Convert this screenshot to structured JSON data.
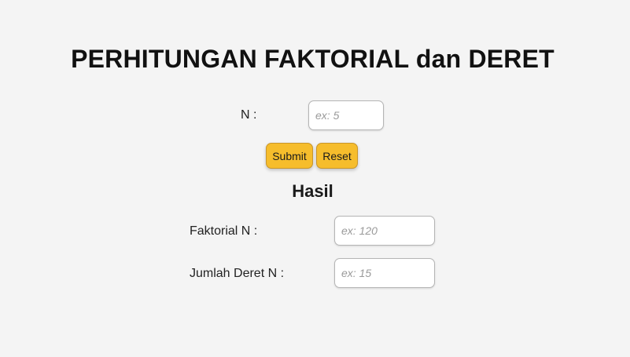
{
  "title": "PERHITUNGAN FAKTORIAL dan DERET",
  "input_form": {
    "n_label": "N :",
    "n_placeholder": "ex: 5",
    "n_value": ""
  },
  "buttons": {
    "submit_label": "Submit",
    "reset_label": "Reset"
  },
  "result": {
    "heading": "Hasil",
    "factorial_label": "Faktorial N :",
    "factorial_placeholder": "ex: 120",
    "series_label": "Jumlah Deret N :",
    "series_placeholder": "ex: 15"
  },
  "colors": {
    "background": "#f4f4f4",
    "button": "#f6bd2c",
    "field_border": "#b5b5b5"
  }
}
